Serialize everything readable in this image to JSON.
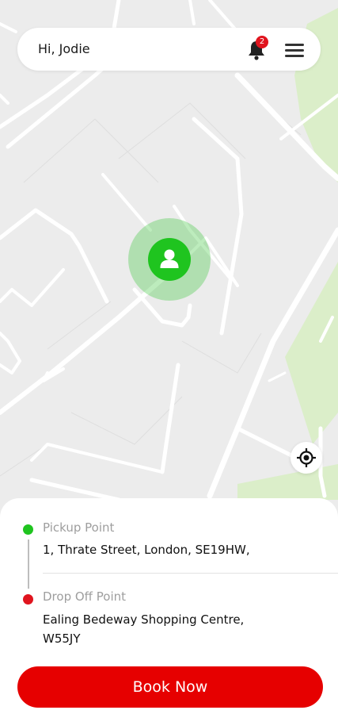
{
  "header": {
    "greeting": "Hi, Jodie",
    "notification_count": "2",
    "icons": {
      "notifications": "bell-icon",
      "menu": "hamburger-menu-icon"
    }
  },
  "map": {
    "user_marker_icon": "person-icon",
    "locate_icon": "crosshair-locate-icon"
  },
  "trip": {
    "pickup_label": "Pickup Point",
    "pickup_address": "1, Thrate Street, London, SE19HW,",
    "dropoff_label": "Drop Off Point",
    "dropoff_line1": "Ealing Bedeway Shopping Centre,",
    "dropoff_line2": "W55JY"
  },
  "actions": {
    "book_label": "Book Now"
  },
  "colors": {
    "accent_red": "#e60000",
    "pickup_green": "#1fc41f",
    "dropoff_red": "#e0141e",
    "map_background": "#ececec",
    "park_green": "#dbeec9"
  }
}
